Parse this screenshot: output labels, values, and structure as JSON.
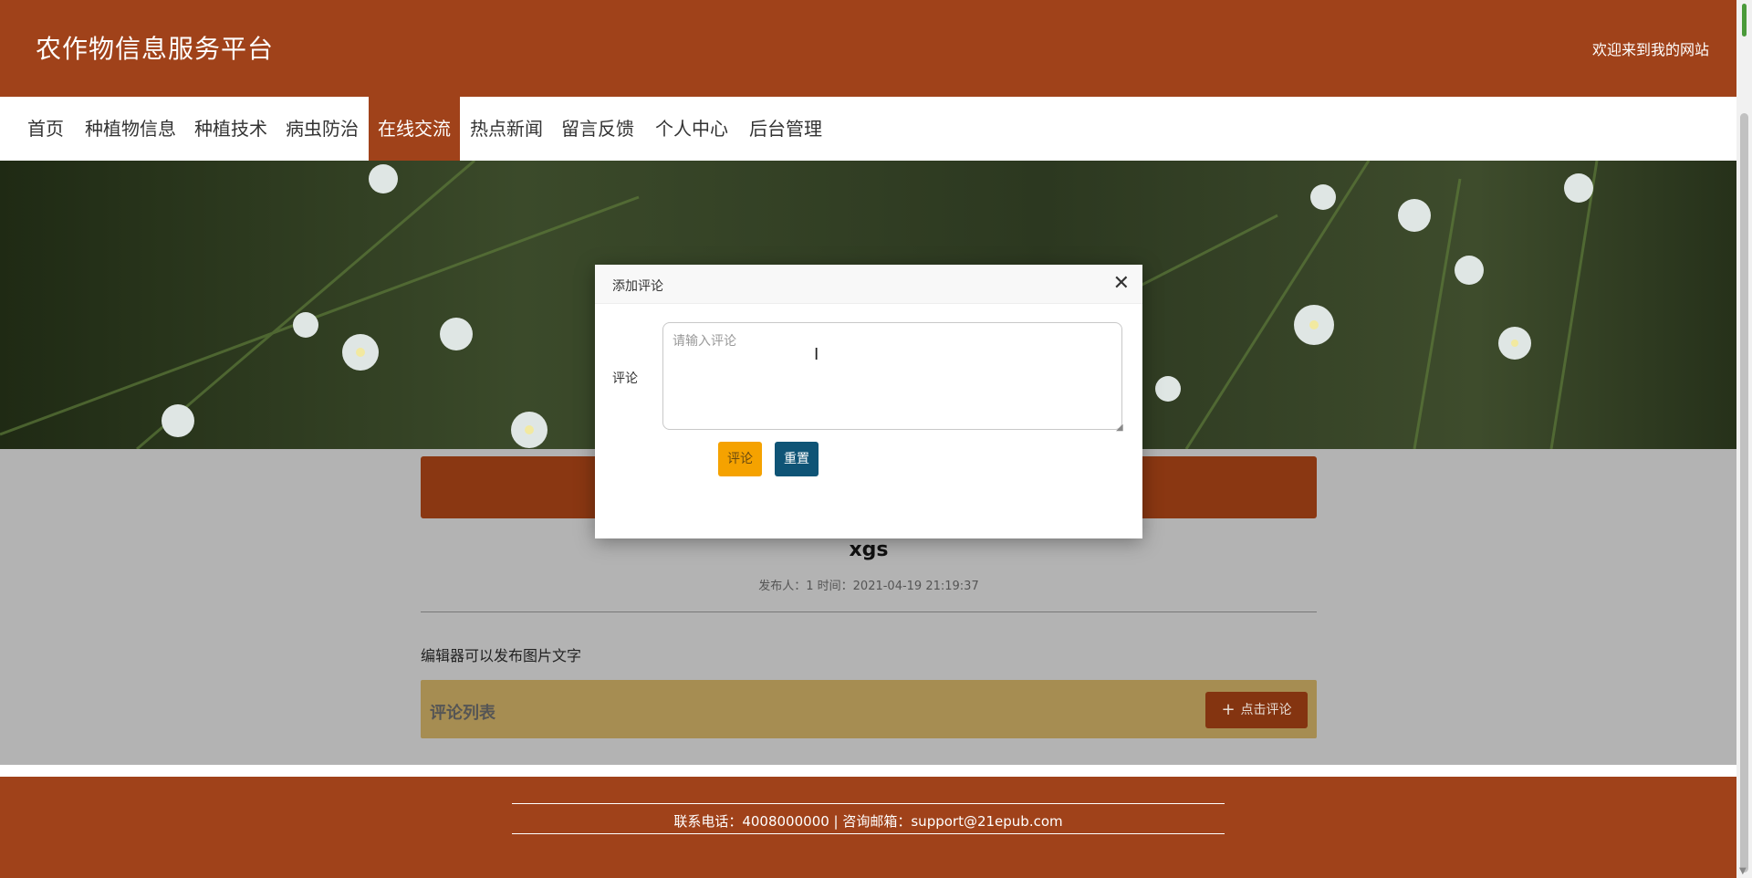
{
  "header": {
    "site_title": "农作物信息服务平台",
    "welcome": "欢迎来到我的网站"
  },
  "nav": {
    "items": [
      {
        "label": "首页"
      },
      {
        "label": "种植物信息"
      },
      {
        "label": "种植技术"
      },
      {
        "label": "病虫防治"
      },
      {
        "label": "在线交流",
        "active": true
      },
      {
        "label": "热点新闻"
      },
      {
        "label": "留言反馈"
      },
      {
        "label": "个人中心"
      },
      {
        "label": "后台管理"
      }
    ]
  },
  "article": {
    "title": "xgs",
    "meta": "发布人：1 时间：2021-04-19 21:19:37",
    "body": "编辑器可以发布图片文字"
  },
  "comments": {
    "title": "评论列表",
    "add_button": "点击评论",
    "add_icon": "plus-icon"
  },
  "footer": {
    "text": "联系电话：4008000000 | 咨询邮箱：support@21epub.com"
  },
  "modal": {
    "title": "添加评论",
    "field_label": "评论",
    "placeholder": "请输入评论",
    "value": "",
    "submit_label": "评论",
    "reset_label": "重置",
    "close_icon": "close-icon"
  },
  "colors": {
    "brand": "#a0421a",
    "submit": "#f5a200",
    "reset": "#0f5476",
    "comment_bar": "#a68d52"
  }
}
